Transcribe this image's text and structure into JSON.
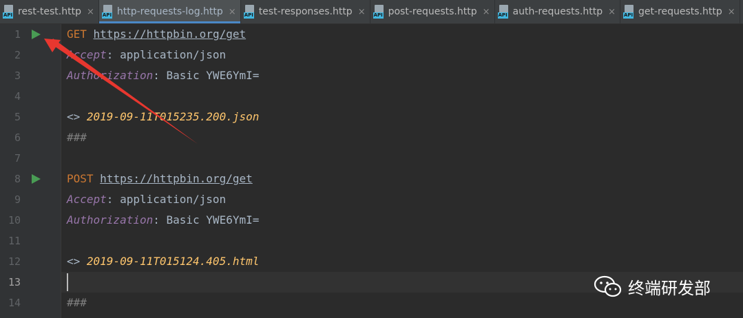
{
  "tabs": [
    {
      "label": "rest-test.http",
      "badge": "API",
      "active": false
    },
    {
      "label": "http-requests-log.http",
      "badge": "API",
      "active": true
    },
    {
      "label": "test-responses.http",
      "badge": "API",
      "active": false
    },
    {
      "label": "post-requests.http",
      "badge": "API",
      "active": false
    },
    {
      "label": "auth-requests.http",
      "badge": "API",
      "active": false
    },
    {
      "label": "get-requests.http",
      "badge": "API",
      "active": false
    }
  ],
  "close_glyph": "×",
  "line_numbers": [
    "1",
    "2",
    "3",
    "4",
    "5",
    "6",
    "7",
    "8",
    "9",
    "10",
    "11",
    "12",
    "13",
    "14"
  ],
  "code": {
    "req1": {
      "method": "GET",
      "url": "https://httpbin.org/get",
      "h1_key": "Accept",
      "h1_val": ": application/json",
      "h2_key": "Authorization",
      "h2_val": ": Basic YWE6YmI=",
      "resp_icon": "<>",
      "resp_file": "2019-09-11T015235.200.json",
      "separator": "###"
    },
    "req2": {
      "method": "POST",
      "url": "https://httpbin.org/get",
      "h1_key": "Accept",
      "h1_val": ": application/json",
      "h2_key": "Authorization",
      "h2_val": ": Basic YWE6YmI=",
      "resp_icon": "<>",
      "resp_file": "2019-09-11T015124.405.html",
      "separator": "###"
    }
  },
  "watermark": {
    "text": "终端研发部",
    "icon": "wechat-icon"
  },
  "colors": {
    "background": "#2b2b2b",
    "method": "#cc7832",
    "header_key": "#9876aa",
    "response_file": "#ffc66d",
    "run_icon": "#499c54",
    "annotation_arrow": "#e8372f"
  }
}
